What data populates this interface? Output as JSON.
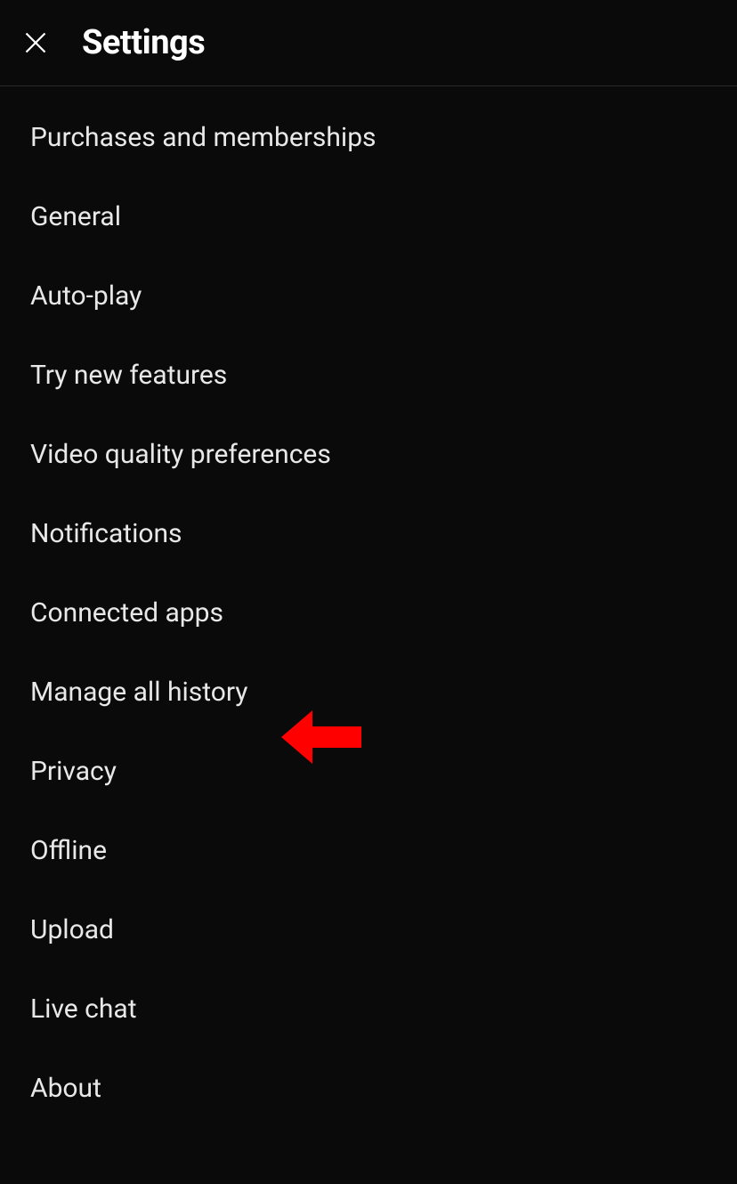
{
  "header": {
    "title": "Settings"
  },
  "settings": {
    "items": [
      {
        "label": "Purchases and memberships",
        "name": "settings-item-purchases"
      },
      {
        "label": "General",
        "name": "settings-item-general"
      },
      {
        "label": "Auto-play",
        "name": "settings-item-autoplay"
      },
      {
        "label": "Try new features",
        "name": "settings-item-new-features"
      },
      {
        "label": "Video quality preferences",
        "name": "settings-item-video-quality"
      },
      {
        "label": "Notifications",
        "name": "settings-item-notifications"
      },
      {
        "label": "Connected apps",
        "name": "settings-item-connected-apps"
      },
      {
        "label": "Manage all history",
        "name": "settings-item-manage-history"
      },
      {
        "label": "Privacy",
        "name": "settings-item-privacy"
      },
      {
        "label": "Offline",
        "name": "settings-item-offline"
      },
      {
        "label": "Upload",
        "name": "settings-item-upload"
      },
      {
        "label": "Live chat",
        "name": "settings-item-live-chat"
      },
      {
        "label": "About",
        "name": "settings-item-about"
      }
    ]
  },
  "annotation": {
    "type": "arrow",
    "color": "#ff0000",
    "target": "settings-item-manage-history"
  }
}
